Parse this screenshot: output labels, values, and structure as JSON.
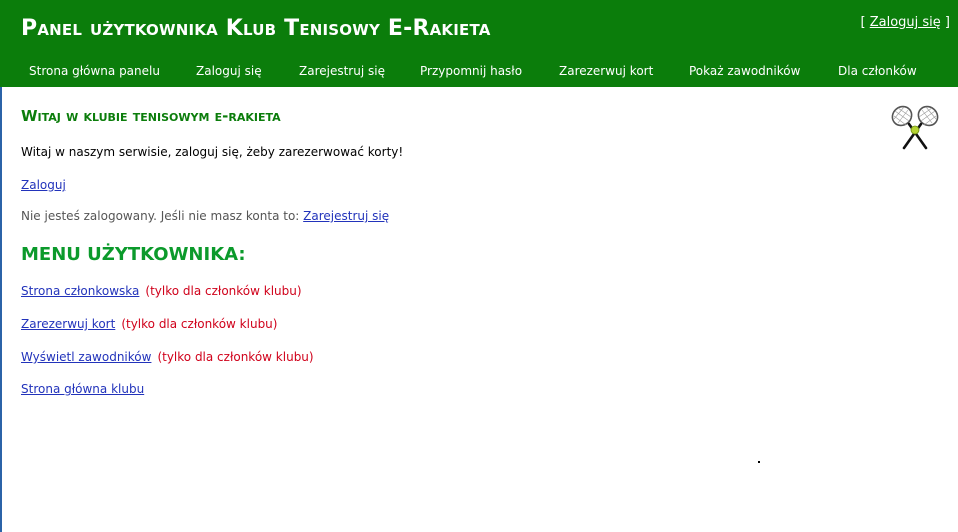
{
  "header": {
    "title": "Panel użytkownika Klub Tenisowy E-Rakieta",
    "login_bracket_open": "[",
    "login_link": "Zaloguj się",
    "login_bracket_close": "]"
  },
  "nav": {
    "items": [
      {
        "label": "Strona główna panelu"
      },
      {
        "label": "Zaloguj się"
      },
      {
        "label": "Zarejestruj się"
      },
      {
        "label": "Przypomnij hasło"
      },
      {
        "label": "Zarezerwuj kort"
      },
      {
        "label": "Pokaż zawodników"
      },
      {
        "label": "Dla członków"
      }
    ]
  },
  "main": {
    "welcome_heading": "Witaj w klubie tenisowym e-rakieta",
    "welcome_text": "Witaj w naszym serwisie, zaloguj się, żeby zarezerwować korty!",
    "login_link": "Zaloguj",
    "status_text": "Nie jesteś zalogowany. Jeśli nie masz konta to:",
    "register_link": "Zarejestruj się",
    "menu_heading": "MENU UŻYTKOWNIKA:",
    "menu_items": [
      {
        "label": "Strona członkowska",
        "note": "(tylko dla członków klubu)"
      },
      {
        "label": "Zarezerwuj kort",
        "note": "(tylko dla członków klubu)"
      },
      {
        "label": "Wyświetl zawodników",
        "note": "(tylko dla członków klubu)"
      },
      {
        "label": "Strona główna klubu",
        "note": ""
      }
    ]
  },
  "icons": {
    "logo": "tennis-rackets-icon"
  },
  "colors": {
    "header_bg": "#0b7d0b",
    "heading_green": "#0b7d0b",
    "menu_heading_green": "#0b9a2b",
    "link_blue": "#2233bb",
    "note_red": "#d0021b"
  }
}
